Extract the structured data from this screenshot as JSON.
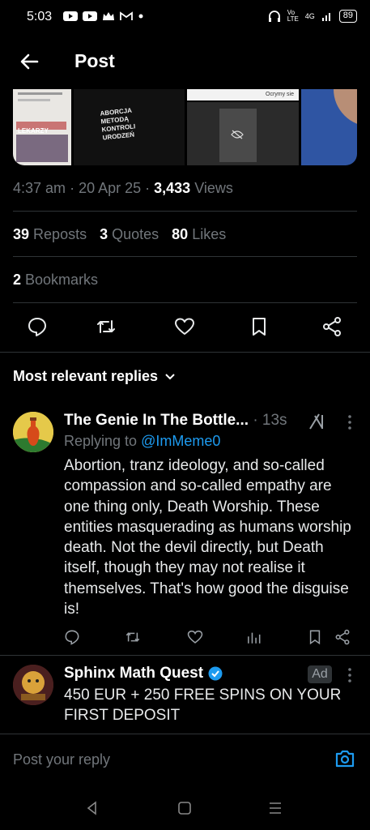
{
  "status": {
    "time": "5:03",
    "network": "4G",
    "battery": "89",
    "volte": "Vo LTE"
  },
  "header": {
    "title": "Post"
  },
  "media": {
    "thumb_text_1": "ABORCJA METODĄ KONTROLI URODZEŃ",
    "thumb_text_2": "LEKARZY",
    "thumb_text_3": "Ocrymy sie"
  },
  "meta": {
    "time": "4:37 am",
    "date": "20 Apr 25",
    "views_count": "3,433",
    "views_label": "Views"
  },
  "stats": {
    "reposts_count": "39",
    "reposts_label": "Reposts",
    "quotes_count": "3",
    "quotes_label": "Quotes",
    "likes_count": "80",
    "likes_label": "Likes"
  },
  "bookmarks": {
    "count": "2",
    "label": "Bookmarks"
  },
  "replies_header": {
    "label": "Most relevant replies"
  },
  "reply_1": {
    "name": "The Genie In The Bottle...",
    "time": "· 13s",
    "replying_to_label": "Replying to",
    "replying_to_handle": "@ImMeme0",
    "text": "Abortion, tranz ideology, and so-called compassion and so-called empathy are one thing only, Death Worship. These entities masquerading as humans worship death. Not the devil directly, but Death itself, though they may not realise it themselves. That's how good the disguise is!"
  },
  "reply_2": {
    "name": "Sphinx Math Quest",
    "ad_label": "Ad",
    "text": "450 EUR + 250 FREE SPINS ON YOUR FIRST DEPOSIT"
  },
  "composer": {
    "placeholder": "Post your reply"
  },
  "colors": {
    "accent": "#1d9bf0",
    "muted": "#71767b",
    "text": "#e7e9ea",
    "divider": "#2f3336"
  }
}
